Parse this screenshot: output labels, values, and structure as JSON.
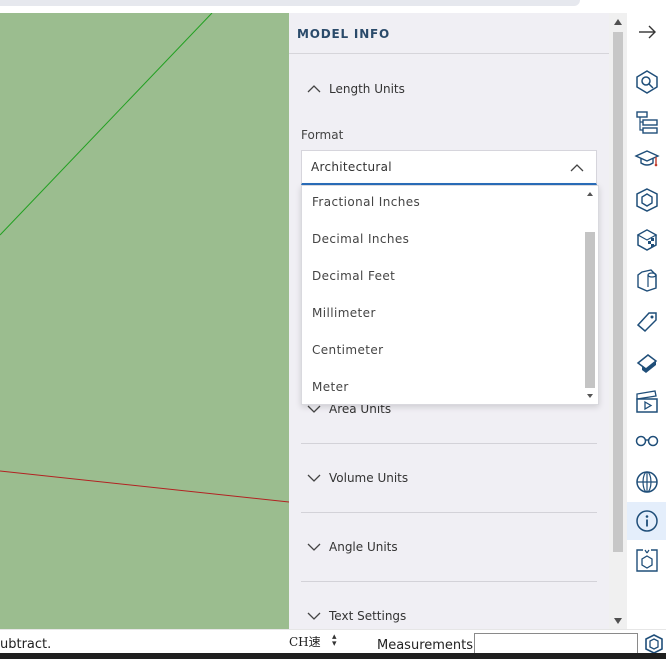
{
  "panel": {
    "title": "MODEL INFO",
    "sections": {
      "length_units": "Length Units",
      "area_units": "Area Units",
      "volume_units": "Volume Units",
      "angle_units": "Angle Units",
      "text_settings": "Text Settings"
    },
    "format_label": "Format",
    "format_selected": "Architectural",
    "format_options": [
      "Fractional Inches",
      "Decimal Inches",
      "Decimal Feet",
      "Millimeter",
      "Centimeter",
      "Meter"
    ]
  },
  "toolbar": {
    "icons": [
      "arrow-right-icon",
      "entity-info-icon",
      "outliner-icon",
      "instructor-icon",
      "components-icon",
      "materials-icon",
      "styles-icon",
      "tags-icon",
      "shadows-icon",
      "scenes-icon",
      "display-icon",
      "geo-location-icon",
      "model-info-icon",
      "model-info-2-icon"
    ],
    "active": "model-info-icon"
  },
  "status": {
    "message": "ubtract.",
    "ime_text": "CH速",
    "measurements_label": "Measurements",
    "measurements_value": ""
  },
  "colors": {
    "viewport": "#9bbd8f",
    "green_axis": "#22a022",
    "red_axis": "#b22222",
    "accent": "#2a6ebb"
  }
}
